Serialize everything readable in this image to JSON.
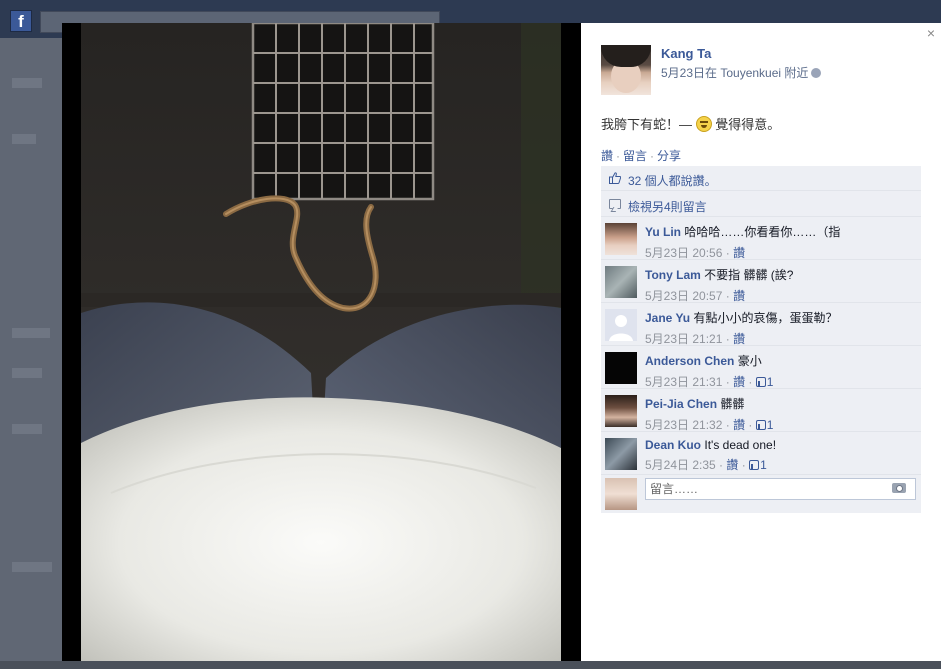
{
  "background": {
    "logo": "f"
  },
  "photo": {
    "alt": "snake-photo"
  },
  "post": {
    "author": "Kang Ta",
    "meta": "5月23日在 Touyenkuei 附近",
    "text_before": "我胯下有蛇！—",
    "feeling": "覺得得意。",
    "close": "×"
  },
  "actions": {
    "like": "讚",
    "comment": "留言",
    "share": "分享",
    "sep": "·"
  },
  "likes": {
    "text": "32 個人都說讚。"
  },
  "view_more": {
    "text": "檢視另4則留言"
  },
  "comments": [
    {
      "name": "Yu Lin",
      "text": "哈哈哈……你看看你……（指",
      "time": "5月23日 20:56",
      "like": "讚",
      "likes": ""
    },
    {
      "name": "Tony Lam",
      "text": "不要指 髒髒 (誒?",
      "time": "5月23日 20:57",
      "like": "讚",
      "likes": ""
    },
    {
      "name": "Jane Yu",
      "text": "有點小小的哀傷，蛋蛋勒？",
      "time": "5月23日 21:21",
      "like": "讚",
      "likes": ""
    },
    {
      "name": "Anderson Chen",
      "text": "豪小",
      "time": "5月23日 21:31",
      "like": "讚",
      "likes": "1"
    },
    {
      "name": "Pei-Jia Chen",
      "text": "髒髒",
      "time": "5月23日 21:32",
      "like": "讚",
      "likes": "1"
    },
    {
      "name": "Dean Kuo",
      "text": "It's dead one!",
      "time": "5月24日 2:35",
      "like": "讚",
      "likes": "1"
    }
  ],
  "write": {
    "placeholder": "留言……"
  },
  "colors": {
    "link": "#3b5998",
    "ufi_bg": "#edeff4"
  }
}
